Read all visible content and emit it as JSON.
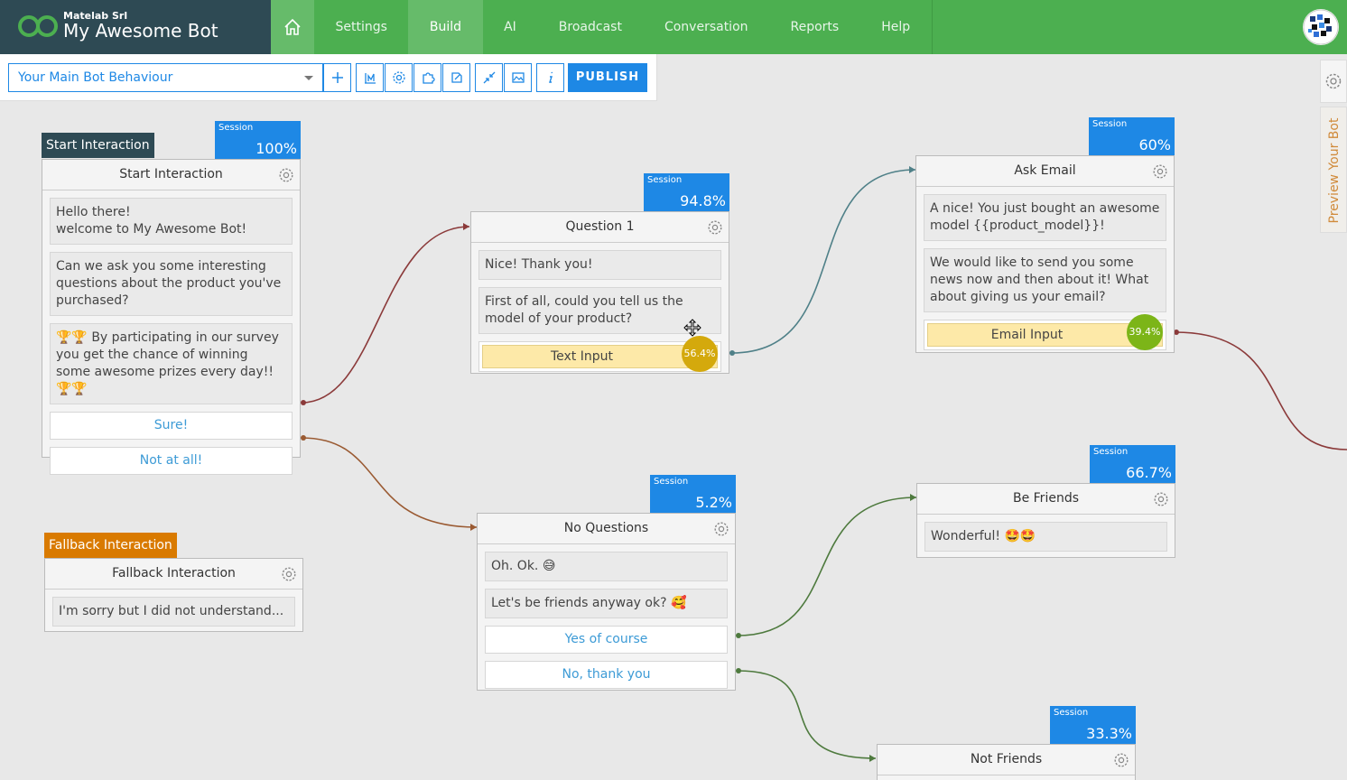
{
  "brand": {
    "company": "Matelab Srl",
    "bot_name": "My Awesome Bot"
  },
  "nav": {
    "items": [
      {
        "label": "Settings"
      },
      {
        "label": "Build"
      },
      {
        "label": "AI"
      },
      {
        "label": "Broadcast"
      },
      {
        "label": "Conversation"
      },
      {
        "label": "Reports"
      },
      {
        "label": "Help"
      }
    ],
    "active": "Build"
  },
  "toolbar": {
    "behaviour_select": "Your Main Bot Behaviour",
    "publish_label": "PUBLISH"
  },
  "sidebar": {
    "preview_label": "Preview Your Bot"
  },
  "nodes": {
    "start": {
      "tag": "Start Interaction",
      "title": "Start Interaction",
      "session_label": "Session",
      "session_value": "100%",
      "messages": [
        "Hello there!\nwelcome to My Awesome Bot!",
        "Can we ask you some interesting questions about the product you've purchased?",
        "🏆🏆 By participating in our survey you get the chance of winning some awesome prizes every day!! 🏆🏆"
      ],
      "buttons": [
        "Sure!",
        "Not at all!"
      ]
    },
    "question1": {
      "title": "Question 1",
      "session_label": "Session",
      "session_value": "94.8%",
      "messages": [
        "Nice! Thank you!",
        "First of all, could you tell us the model of your product?"
      ],
      "input_label": "Text Input",
      "input_pct": "56.4%"
    },
    "ask_email": {
      "title": "Ask Email",
      "session_label": "Session",
      "session_value": "60%",
      "messages": [
        "A nice! You just bought an awesome model {{product_model}}!",
        "We would like to send you some news now and then about it! What about giving us your email?"
      ],
      "input_label": "Email Input",
      "input_pct": "39.4%"
    },
    "no_questions": {
      "title": "No Questions",
      "session_label": "Session",
      "session_value": "5.2%",
      "messages": [
        "Oh. Ok. 😅",
        "Let's be friends anyway ok? 🥰"
      ],
      "buttons": [
        "Yes of course",
        "No, thank you"
      ]
    },
    "be_friends": {
      "title": "Be Friends",
      "session_label": "Session",
      "session_value": "66.7%",
      "messages": [
        "Wonderful! 🤩🤩"
      ]
    },
    "fallback": {
      "tag": "Fallback Interaction",
      "title": "Fallback Interaction",
      "messages": [
        "I'm sorry but I did not understand..."
      ]
    },
    "not_friends": {
      "title": "Not Friends",
      "session_label": "Session",
      "session_value": "33.3%"
    }
  },
  "colors": {
    "topbar": "#4caf50",
    "brand_bg": "#2e4a54",
    "accent": "#1e88e5",
    "start_tag": "#2e4a54",
    "fallback_tag": "#d97a00",
    "pct_yellow": "#d4a90c",
    "pct_green": "#7cb518",
    "link_red": "#8b3a3a",
    "link_teal": "#4f8088",
    "link_brown": "#9a5a32",
    "link_green": "#4e7a3e"
  },
  "icons": [
    "home-icon",
    "gear-icon",
    "plus-icon",
    "chart-icon",
    "puzzle-icon",
    "export-icon",
    "collapse-icon",
    "image-icon",
    "info-icon",
    "move-cursor-icon"
  ]
}
